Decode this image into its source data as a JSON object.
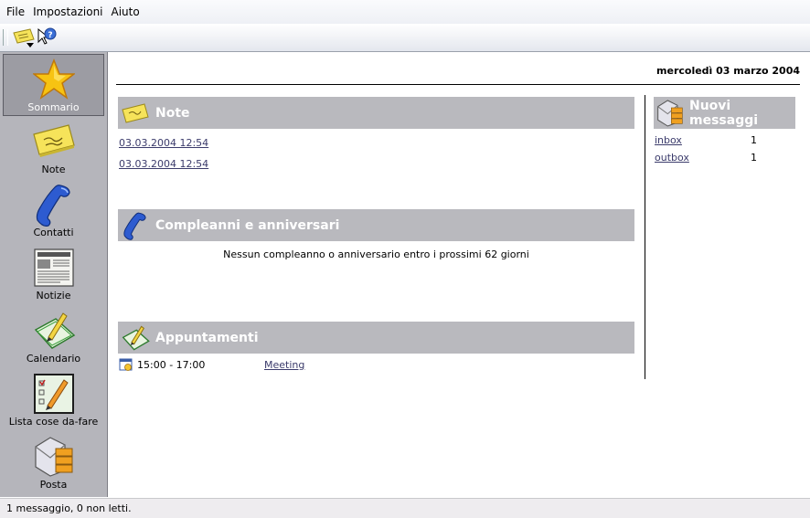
{
  "menu": {
    "file": "File",
    "settings": "Impostazioni",
    "help": "Aiuto"
  },
  "sidebar": {
    "items": [
      {
        "label": "Sommario",
        "icon": "star-icon",
        "active": true
      },
      {
        "label": "Note",
        "icon": "sticky-note-icon"
      },
      {
        "label": "Contatti",
        "icon": "phone-icon"
      },
      {
        "label": "Notizie",
        "icon": "newspaper-icon"
      },
      {
        "label": "Calendario",
        "icon": "calendar-pen-icon"
      },
      {
        "label": "Lista cose da-fare",
        "icon": "todo-list-icon"
      },
      {
        "label": "Posta",
        "icon": "mail-icon"
      }
    ]
  },
  "summary": {
    "date": "mercoledì 03 marzo 2004",
    "notes": {
      "title": "Note",
      "items": [
        "03.03.2004 12:54",
        "03.03.2004 12:54"
      ]
    },
    "birthdays": {
      "title": "Compleanni e anniversari",
      "empty_message": "Nessun compleanno o anniversario entro i prossimi 62 giorni"
    },
    "appointments": {
      "title": "Appuntamenti",
      "items": [
        {
          "time": "15:00 - 17:00",
          "title": "Meeting"
        }
      ]
    },
    "messages": {
      "title": "Nuovi messaggi",
      "folders": [
        {
          "name": "inbox",
          "count": "1"
        },
        {
          "name": "outbox",
          "count": "1"
        }
      ]
    }
  },
  "status": {
    "text": "1 messaggio, 0 non letti."
  },
  "colors": {
    "sidebar_bg": "#b5b5bb",
    "section_header_bg": "#b9b9be",
    "link": "#3b3b6b"
  }
}
